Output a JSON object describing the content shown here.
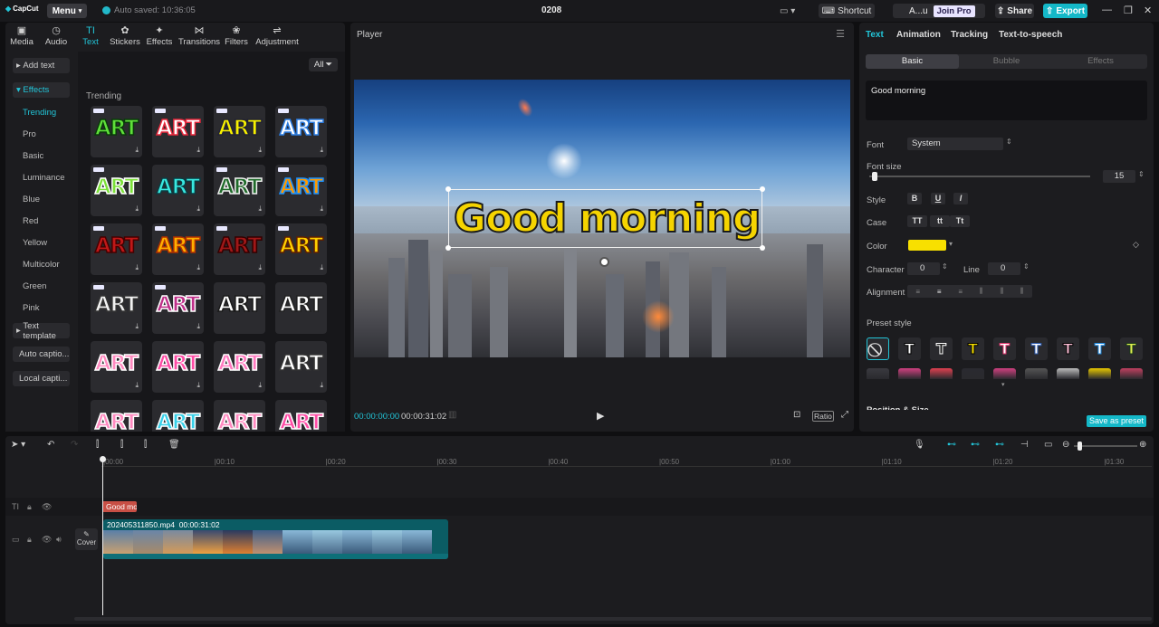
{
  "titlebar": {
    "app_name": "CapCut",
    "menu_label": "Menu",
    "autosave": "Auto saved: 10:36:05",
    "project_title": "0208",
    "shortcut_label": "Shortcut",
    "account_name": "A...u",
    "join_pro_label": "Join Pro",
    "share_label": "Share",
    "export_label": "Export"
  },
  "toolbar": {
    "tabs": [
      {
        "label": "Media",
        "icon": "media-icon"
      },
      {
        "label": "Audio",
        "icon": "audio-icon"
      },
      {
        "label": "Text",
        "icon": "text-icon",
        "active": true
      },
      {
        "label": "Stickers",
        "icon": "stickers-icon"
      },
      {
        "label": "Effects",
        "icon": "effects-icon"
      },
      {
        "label": "Transitions",
        "icon": "transitions-icon"
      },
      {
        "label": "Filters",
        "icon": "filters-icon"
      },
      {
        "label": "Adjustment",
        "icon": "adjustment-icon"
      }
    ]
  },
  "sidebar": {
    "add_text": "Add text",
    "effects": "Effects",
    "sub_items": [
      "Trending",
      "Pro",
      "Basic",
      "Luminance",
      "Blue",
      "Red",
      "Yellow",
      "Multicolor",
      "Green",
      "Pink"
    ],
    "text_template": "Text template",
    "auto_captions": "Auto captio...",
    "local_captions": "Local capti..."
  },
  "effects_grid": {
    "filter_label": "All",
    "section_title": "Trending",
    "tile_text": "ART"
  },
  "player": {
    "header": "Player",
    "overlay_text": "Good morning",
    "current_time": "00:00:00:00",
    "total_time": "00:00:31:02",
    "ratio_label": "Ratio"
  },
  "right_panel": {
    "tabs": [
      "Text",
      "Animation",
      "Tracking",
      "Text-to-speech"
    ],
    "segments": [
      "Basic",
      "Bubble",
      "Effects"
    ],
    "text_value": "Good morning",
    "font_label": "Font",
    "font_value": "System",
    "font_size_label": "Font size",
    "font_size_value": "15",
    "style_label": "Style",
    "style_buttons": [
      "B",
      "U",
      "I"
    ],
    "case_label": "Case",
    "case_buttons": [
      "TT",
      "tt",
      "Tt"
    ],
    "color_label": "Color",
    "color_value": "#f8e000",
    "character_label": "Character",
    "character_value": "0",
    "line_label": "Line",
    "line_value": "0",
    "alignment_label": "Alignment",
    "preset_label": "Preset style",
    "preset_glyph": "T",
    "position_label": "Position & Size",
    "save_preset_label": "Save as preset"
  },
  "timeline": {
    "ruler": [
      "00:00",
      "00:10",
      "00:20",
      "00:30",
      "00:40",
      "00:50",
      "01:00",
      "01:10",
      "01:20",
      "01:30"
    ],
    "text_clip": "Good mo",
    "video_clip_name": "202405311850.mp4",
    "video_clip_duration": "00:00:31:02",
    "cover_label": "Cover"
  }
}
